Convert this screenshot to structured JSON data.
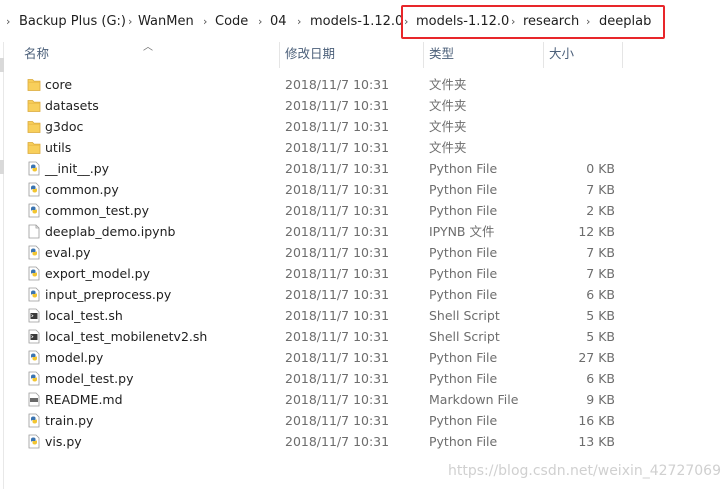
{
  "breadcrumb": {
    "items": [
      "Backup Plus (G:)",
      "WanMen",
      "Code",
      "04",
      "models-1.12.0",
      "models-1.12.0",
      "research",
      "deeplab"
    ],
    "highlight_color": "#e8262a"
  },
  "columns": {
    "name": "名称",
    "modified": "修改日期",
    "type": "类型",
    "size": "大小",
    "sorted_column": "name"
  },
  "files": [
    {
      "name": "core",
      "modified": "2018/11/7 10:31",
      "type": "文件夹",
      "size": "",
      "icon": "folder-icon"
    },
    {
      "name": "datasets",
      "modified": "2018/11/7 10:31",
      "type": "文件夹",
      "size": "",
      "icon": "folder-icon"
    },
    {
      "name": "g3doc",
      "modified": "2018/11/7 10:31",
      "type": "文件夹",
      "size": "",
      "icon": "folder-icon"
    },
    {
      "name": "utils",
      "modified": "2018/11/7 10:31",
      "type": "文件夹",
      "size": "",
      "icon": "folder-icon"
    },
    {
      "name": "__init__.py",
      "modified": "2018/11/7 10:31",
      "type": "Python File",
      "size": "0 KB",
      "icon": "python-file-icon"
    },
    {
      "name": "common.py",
      "modified": "2018/11/7 10:31",
      "type": "Python File",
      "size": "7 KB",
      "icon": "python-file-icon"
    },
    {
      "name": "common_test.py",
      "modified": "2018/11/7 10:31",
      "type": "Python File",
      "size": "2 KB",
      "icon": "python-file-icon"
    },
    {
      "name": "deeplab_demo.ipynb",
      "modified": "2018/11/7 10:31",
      "type": "IPYNB 文件",
      "size": "12 KB",
      "icon": "blank-file-icon"
    },
    {
      "name": "eval.py",
      "modified": "2018/11/7 10:31",
      "type": "Python File",
      "size": "7 KB",
      "icon": "python-file-icon"
    },
    {
      "name": "export_model.py",
      "modified": "2018/11/7 10:31",
      "type": "Python File",
      "size": "7 KB",
      "icon": "python-file-icon"
    },
    {
      "name": "input_preprocess.py",
      "modified": "2018/11/7 10:31",
      "type": "Python File",
      "size": "6 KB",
      "icon": "python-file-icon"
    },
    {
      "name": "local_test.sh",
      "modified": "2018/11/7 10:31",
      "type": "Shell Script",
      "size": "5 KB",
      "icon": "shell-script-icon"
    },
    {
      "name": "local_test_mobilenetv2.sh",
      "modified": "2018/11/7 10:31",
      "type": "Shell Script",
      "size": "5 KB",
      "icon": "shell-script-icon"
    },
    {
      "name": "model.py",
      "modified": "2018/11/7 10:31",
      "type": "Python File",
      "size": "27 KB",
      "icon": "python-file-icon"
    },
    {
      "name": "model_test.py",
      "modified": "2018/11/7 10:31",
      "type": "Python File",
      "size": "6 KB",
      "icon": "python-file-icon"
    },
    {
      "name": "README.md",
      "modified": "2018/11/7 10:31",
      "type": "Markdown File",
      "size": "9 KB",
      "icon": "markdown-file-icon"
    },
    {
      "name": "train.py",
      "modified": "2018/11/7 10:31",
      "type": "Python File",
      "size": "16 KB",
      "icon": "python-file-icon"
    },
    {
      "name": "vis.py",
      "modified": "2018/11/7 10:31",
      "type": "Python File",
      "size": "13 KB",
      "icon": "python-file-icon"
    }
  ],
  "watermark": "https://blog.csdn.net/weixin_42727069",
  "colors": {
    "folder": "#f8cf5b",
    "python_blue": "#3b74b0",
    "python_yellow": "#f2c530",
    "header_text": "#4c607a"
  }
}
